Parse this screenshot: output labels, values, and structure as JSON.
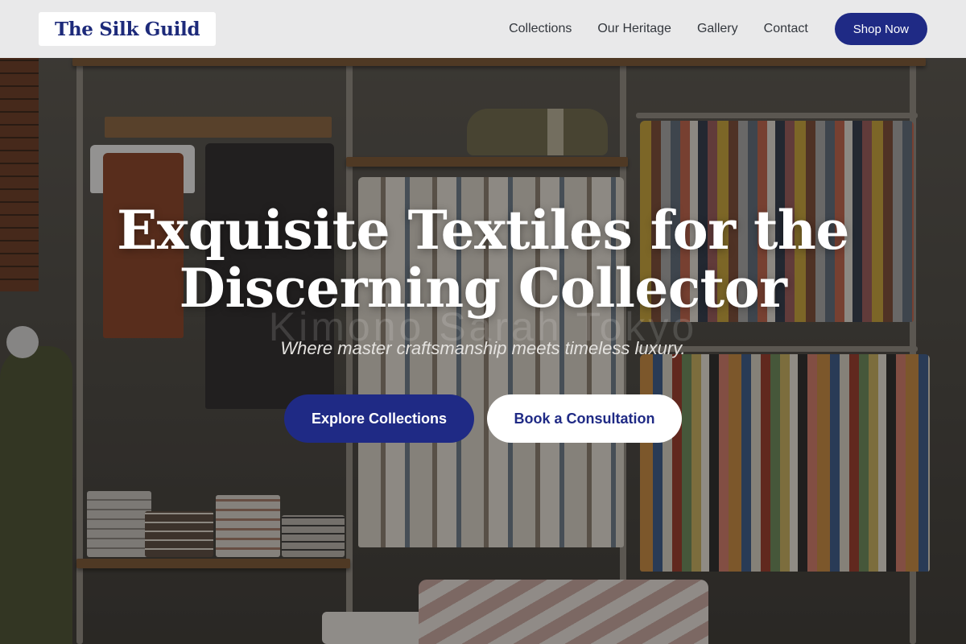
{
  "brand": {
    "name": "The Silk Guild",
    "color": "#1d2a7a"
  },
  "nav": {
    "links": [
      "Collections",
      "Our Heritage",
      "Gallery",
      "Contact"
    ],
    "cta_label": "Shop Now",
    "cta_color": "#1f2a85"
  },
  "hero": {
    "title_line1": "Exquisite Textiles for the",
    "title_line2": "Discerning Collector",
    "watermark": "Kimono Sarah Tokyo",
    "subtitle": "Where master craftsmanship meets timeless luxury.",
    "primary_cta": "Explore Collections",
    "secondary_cta": "Book a Consultation",
    "background": "boutique clothing store interior"
  }
}
